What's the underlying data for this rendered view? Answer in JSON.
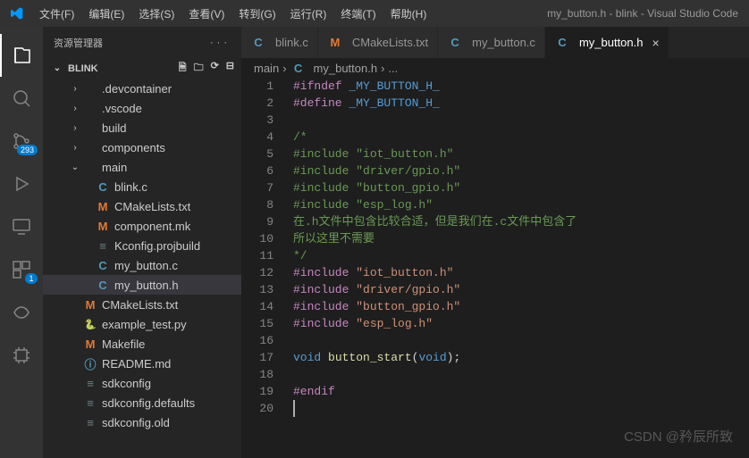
{
  "window": {
    "title": "my_button.h - blink - Visual Studio Code"
  },
  "menu": [
    "文件(F)",
    "编辑(E)",
    "选择(S)",
    "查看(V)",
    "转到(G)",
    "运行(R)",
    "终端(T)",
    "帮助(H)"
  ],
  "activity": {
    "scm_badge": "293",
    "ext_badge": "1"
  },
  "sidebar": {
    "title": "资源管理器",
    "more": "···",
    "root": "BLINK",
    "items": [
      {
        "label": ".devcontainer",
        "indent": 1,
        "chev": "›",
        "icon": "",
        "name": "folder-devcontainer"
      },
      {
        "label": ".vscode",
        "indent": 1,
        "chev": "›",
        "icon": "",
        "name": "folder-vscode"
      },
      {
        "label": "build",
        "indent": 1,
        "chev": "›",
        "icon": "",
        "name": "folder-build"
      },
      {
        "label": "components",
        "indent": 1,
        "chev": "›",
        "icon": "",
        "name": "folder-components"
      },
      {
        "label": "main",
        "indent": 1,
        "chev": "⌄",
        "icon": "",
        "name": "folder-main"
      },
      {
        "label": "blink.c",
        "indent": 2,
        "icon": "C",
        "iclass": "ic-c",
        "name": "file-blink-c"
      },
      {
        "label": "CMakeLists.txt",
        "indent": 2,
        "icon": "M",
        "iclass": "ic-m",
        "name": "file-main-cmakelists"
      },
      {
        "label": "component.mk",
        "indent": 2,
        "icon": "M",
        "iclass": "ic-m",
        "name": "file-component-mk"
      },
      {
        "label": "Kconfig.projbuild",
        "indent": 2,
        "icon": "≡",
        "iclass": "ic-conf",
        "name": "file-kconfig"
      },
      {
        "label": "my_button.c",
        "indent": 2,
        "icon": "C",
        "iclass": "ic-c",
        "name": "file-my-button-c"
      },
      {
        "label": "my_button.h",
        "indent": 2,
        "icon": "C",
        "iclass": "ic-c",
        "active": true,
        "name": "file-my-button-h"
      },
      {
        "label": "CMakeLists.txt",
        "indent": 1,
        "icon": "M",
        "iclass": "ic-m",
        "name": "file-root-cmakelists"
      },
      {
        "label": "example_test.py",
        "indent": 1,
        "icon": "🐍",
        "iclass": "ic-py",
        "name": "file-example-test"
      },
      {
        "label": "Makefile",
        "indent": 1,
        "icon": "M",
        "iclass": "ic-m",
        "name": "file-makefile"
      },
      {
        "label": "README.md",
        "indent": 1,
        "icon": "ⓘ",
        "iclass": "ic-info",
        "name": "file-readme"
      },
      {
        "label": "sdkconfig",
        "indent": 1,
        "icon": "≡",
        "iclass": "ic-conf",
        "name": "file-sdkconfig"
      },
      {
        "label": "sdkconfig.defaults",
        "indent": 1,
        "icon": "≡",
        "iclass": "ic-conf",
        "name": "file-sdkconfig-defaults"
      },
      {
        "label": "sdkconfig.old",
        "indent": 1,
        "icon": "≡",
        "iclass": "ic-conf",
        "name": "file-sdkconfig-old"
      }
    ]
  },
  "tabs": [
    {
      "label": "blink.c",
      "icon": "C",
      "iclass": "ic-c"
    },
    {
      "label": "CMakeLists.txt",
      "icon": "M",
      "iclass": "ic-m"
    },
    {
      "label": "my_button.c",
      "icon": "C",
      "iclass": "ic-c"
    },
    {
      "label": "my_button.h",
      "icon": "C",
      "iclass": "ic-c",
      "active": true,
      "close": "×"
    }
  ],
  "breadcrumb": {
    "p0": "main",
    "sep": "›",
    "icon": "C",
    "p1": "my_button.h",
    "p2": "..."
  },
  "code": {
    "lines": [
      {
        "n": 1,
        "tokens": [
          {
            "t": "#ifndef ",
            "c": "tok-macro"
          },
          {
            "t": "_MY_BUTTON_H_",
            "c": "tok-ident"
          }
        ]
      },
      {
        "n": 2,
        "tokens": [
          {
            "t": "#define ",
            "c": "tok-macro"
          },
          {
            "t": "_MY_BUTTON_H_",
            "c": "tok-ident"
          }
        ]
      },
      {
        "n": 3,
        "tokens": []
      },
      {
        "n": 4,
        "tokens": [
          {
            "t": "/*",
            "c": "tok-comment"
          }
        ]
      },
      {
        "n": 5,
        "tokens": [
          {
            "t": "#include \"iot_button.h\"",
            "c": "tok-comment"
          }
        ]
      },
      {
        "n": 6,
        "tokens": [
          {
            "t": "#include \"driver/gpio.h\"",
            "c": "tok-comment"
          }
        ]
      },
      {
        "n": 7,
        "tokens": [
          {
            "t": "#include \"button_gpio.h\"",
            "c": "tok-comment"
          }
        ]
      },
      {
        "n": 8,
        "tokens": [
          {
            "t": "#include \"esp_log.h\"",
            "c": "tok-comment"
          }
        ]
      },
      {
        "n": 9,
        "tokens": [
          {
            "t": "在.h文件中包含比较合适，但是我们在.c文件中包含了",
            "c": "tok-comment"
          }
        ]
      },
      {
        "n": 10,
        "tokens": [
          {
            "t": "所以这里不需要",
            "c": "tok-comment"
          }
        ]
      },
      {
        "n": 11,
        "tokens": [
          {
            "t": "*/",
            "c": "tok-comment"
          }
        ]
      },
      {
        "n": 12,
        "tokens": [
          {
            "t": "#include ",
            "c": "tok-macro"
          },
          {
            "t": "\"iot_button.h\"",
            "c": "tok-str"
          }
        ]
      },
      {
        "n": 13,
        "tokens": [
          {
            "t": "#include ",
            "c": "tok-macro"
          },
          {
            "t": "\"driver/gpio.h\"",
            "c": "tok-str"
          }
        ]
      },
      {
        "n": 14,
        "tokens": [
          {
            "t": "#include ",
            "c": "tok-macro"
          },
          {
            "t": "\"button_gpio.h\"",
            "c": "tok-str"
          }
        ]
      },
      {
        "n": 15,
        "tokens": [
          {
            "t": "#include ",
            "c": "tok-macro"
          },
          {
            "t": "\"esp_log.h\"",
            "c": "tok-str"
          }
        ]
      },
      {
        "n": 16,
        "tokens": []
      },
      {
        "n": 17,
        "tokens": [
          {
            "t": "void ",
            "c": "tok-type"
          },
          {
            "t": "button_start",
            "c": "tok-func"
          },
          {
            "t": "(",
            "c": "tok-punct"
          },
          {
            "t": "void",
            "c": "tok-type"
          },
          {
            "t": ");",
            "c": "tok-punct"
          }
        ]
      },
      {
        "n": 18,
        "tokens": []
      },
      {
        "n": 19,
        "tokens": [
          {
            "t": "#endif",
            "c": "tok-macro"
          }
        ]
      },
      {
        "n": 20,
        "tokens": [],
        "cursor": true
      }
    ]
  },
  "watermark": "CSDN @矜辰所致"
}
